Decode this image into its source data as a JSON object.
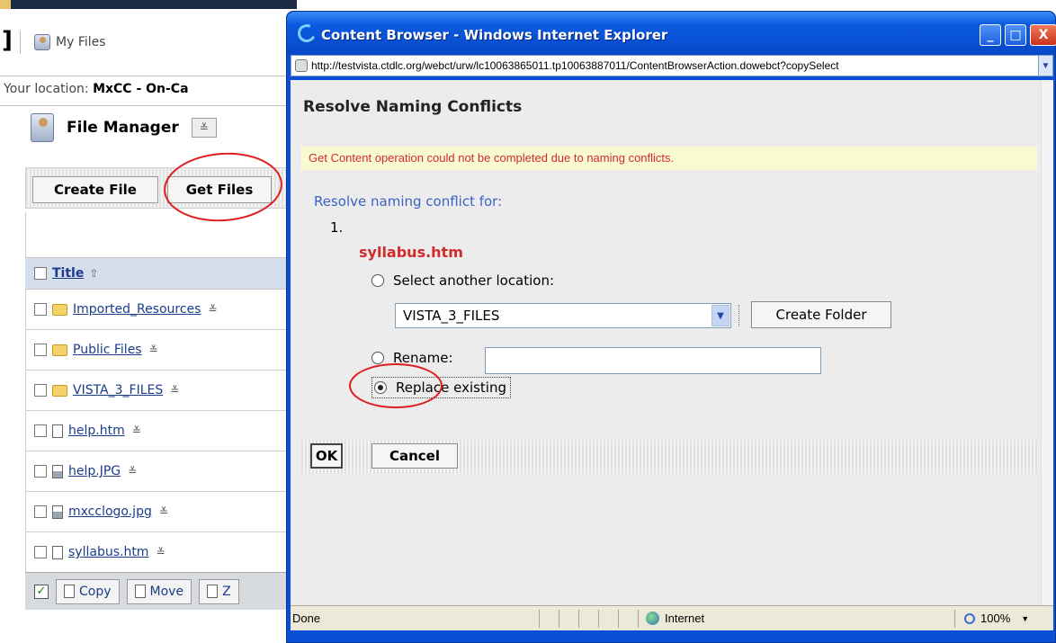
{
  "background_page": {
    "my_files_label": "My Files",
    "location_label": "Your location:",
    "location_value": "MxCC - On-Ca",
    "file_manager_title": "File Manager",
    "menu_glyph": "≚",
    "create_file_label": "Create File",
    "get_files_label": "Get Files",
    "title_header": "Title",
    "sort_glyph": "⇧",
    "files": [
      {
        "name": "Imported_Resources",
        "type": "folder"
      },
      {
        "name": "Public Files",
        "type": "folder"
      },
      {
        "name": "VISTA_3_FILES",
        "type": "folder"
      },
      {
        "name": "help.htm",
        "type": "document"
      },
      {
        "name": "help.JPG",
        "type": "image"
      },
      {
        "name": "mxcclogo.jpg",
        "type": "image"
      },
      {
        "name": "syllabus.htm",
        "type": "document"
      }
    ],
    "bottom_bar": {
      "copy_label": "Copy",
      "move_label": "Move",
      "zip_label": "Z"
    }
  },
  "ie_window": {
    "title": "Content Browser - Windows Internet Explorer",
    "minimize_glyph": "_",
    "maximize_glyph": "□",
    "close_glyph": "X",
    "address_url": "http://testvista.ctdlc.org/webct/urw/lc10063865011.tp10063887011/ContentBrowserAction.dowebct?copySelect",
    "dialog": {
      "heading": "Resolve Naming Conflicts",
      "error_message": "Get Content operation could not be completed due to naming conflicts.",
      "resolve_for_label": "Resolve naming conflict for:",
      "item_number": "1.",
      "conflicting_file": "syllabus.htm",
      "option_select_location": "Select another location:",
      "location_selected": "VISTA_3_FILES",
      "create_folder_label": "Create Folder",
      "option_rename": "Rename:",
      "rename_value": "",
      "option_replace": "Replace existing",
      "selected_option": "replace",
      "ok_label": "OK",
      "cancel_label": "Cancel"
    },
    "statusbar": {
      "status_text": "Done",
      "zone": "Internet",
      "zoom": "100%"
    }
  },
  "colors": {
    "titlebar_blue": "#0a5ae0",
    "error_red": "#d12b2b",
    "link_blue": "#1a3c8a",
    "annotation_red": "#e01b1b"
  }
}
